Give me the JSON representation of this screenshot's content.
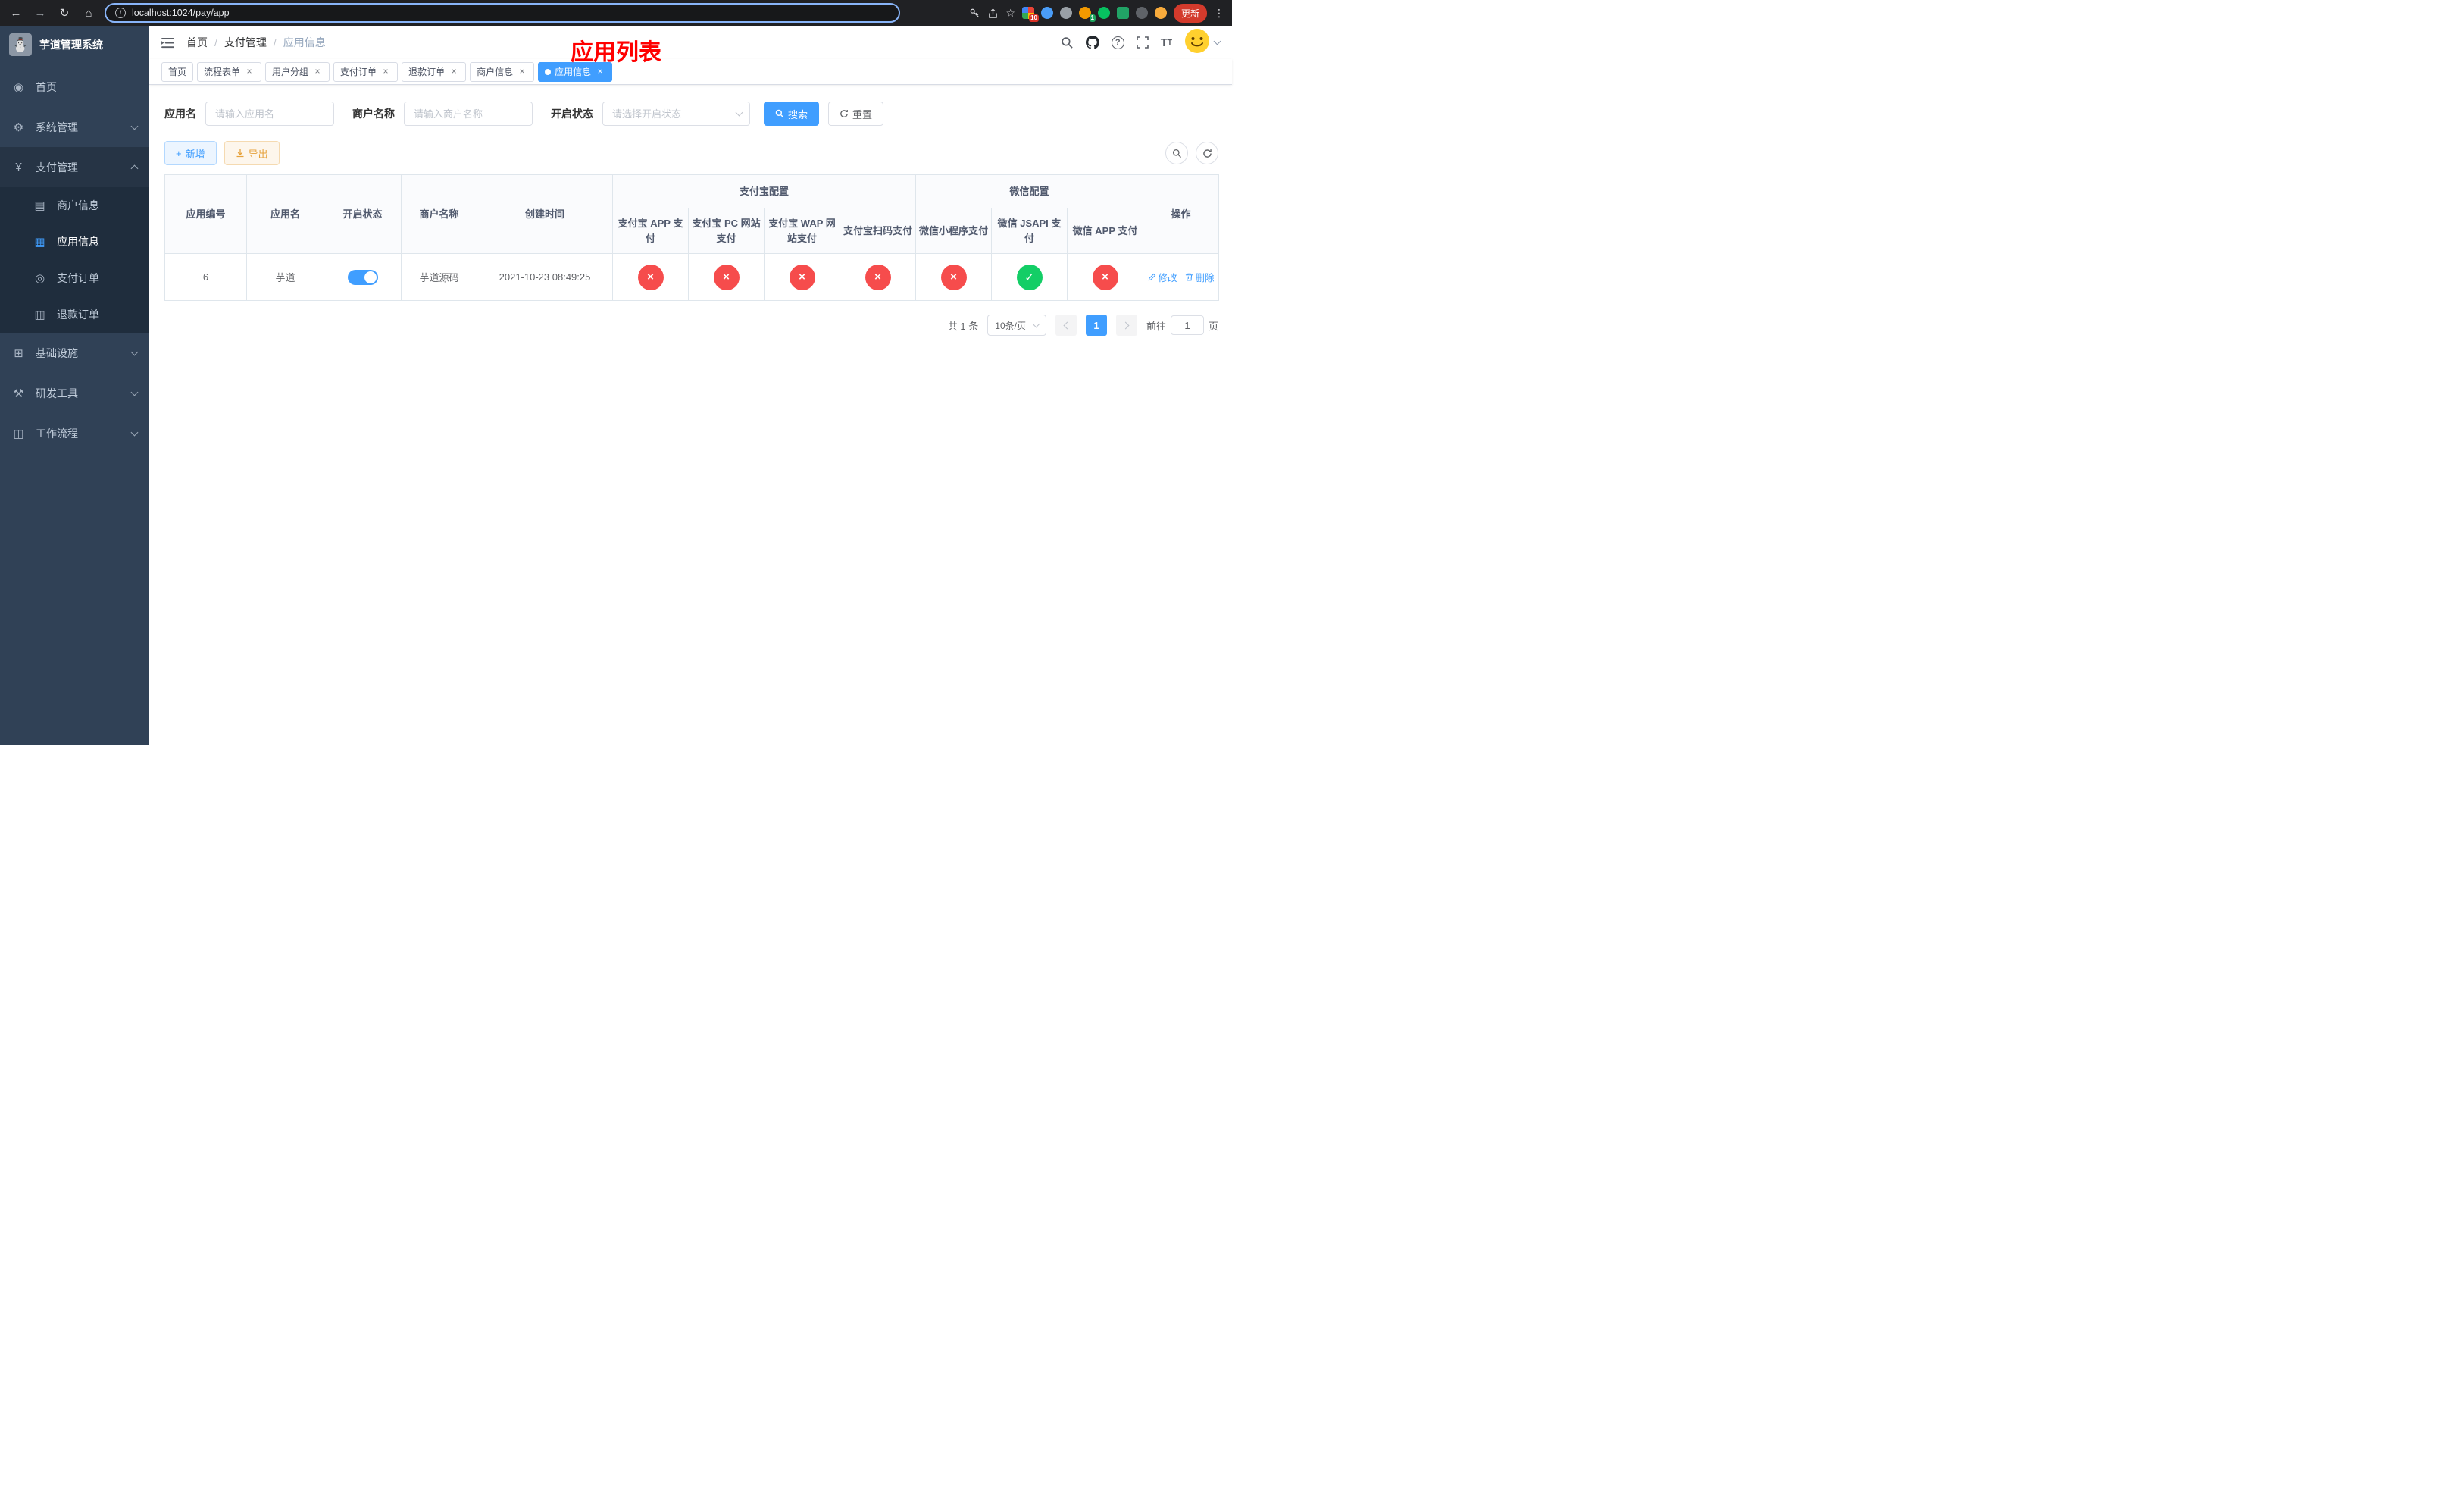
{
  "browser": {
    "url": "localhost:1024/pay/app",
    "update_label": "更新",
    "extensions_badge": "10",
    "profile_badge": "1"
  },
  "sidebar": {
    "title": "芋道管理系统",
    "items": [
      {
        "label": "首页"
      },
      {
        "label": "系统管理"
      },
      {
        "label": "支付管理"
      },
      {
        "label": "基础设施"
      },
      {
        "label": "研发工具"
      },
      {
        "label": "工作流程"
      }
    ],
    "payment_children": [
      {
        "label": "商户信息"
      },
      {
        "label": "应用信息",
        "active": true
      },
      {
        "label": "支付订单"
      },
      {
        "label": "退款订单"
      }
    ]
  },
  "header": {
    "breadcrumb": [
      "首页",
      "支付管理",
      "应用信息"
    ],
    "annotation": "应用列表"
  },
  "tabs": [
    {
      "label": "首页",
      "closable": false
    },
    {
      "label": "流程表单",
      "closable": true
    },
    {
      "label": "用户分组",
      "closable": true
    },
    {
      "label": "支付订单",
      "closable": true
    },
    {
      "label": "退款订单",
      "closable": true
    },
    {
      "label": "商户信息",
      "closable": true
    },
    {
      "label": "应用信息",
      "closable": true,
      "active": true
    }
  ],
  "filters": {
    "app_name_label": "应用名",
    "app_name_placeholder": "请输入应用名",
    "merchant_label": "商户名称",
    "merchant_placeholder": "请输入商户名称",
    "status_label": "开启状态",
    "status_placeholder": "请选择开启状态",
    "search_label": "搜索",
    "reset_label": "重置"
  },
  "toolbar": {
    "add_label": "新增",
    "export_label": "导出"
  },
  "table": {
    "columns": {
      "id": "应用编号",
      "name": "应用名",
      "status": "开启状态",
      "merchant": "商户名称",
      "created": "创建时间",
      "actions": "操作"
    },
    "groups": {
      "alipay": "支付宝配置",
      "wechat": "微信配置"
    },
    "sub_columns": [
      "支付宝 APP 支付",
      "支付宝 PC 网站支付",
      "支付宝 WAP 网站支付",
      "支付宝扫码支付",
      "微信小程序支付",
      "微信 JSAPI 支付",
      "微信 APP 支付"
    ],
    "rows": [
      {
        "id": "6",
        "name": "芋道",
        "enabled": true,
        "merchant": "芋道源码",
        "created": "2021-10-23 08:49:25",
        "statuses": [
          "no",
          "no",
          "no",
          "no",
          "no",
          "yes",
          "no"
        ],
        "actions": [
          "修改",
          "删除"
        ]
      }
    ]
  },
  "pagination": {
    "total": "共 1 条",
    "page_size": "10条/页",
    "current_page": "1",
    "goto_prefix": "前往",
    "goto_value": "1",
    "goto_suffix": "页"
  }
}
